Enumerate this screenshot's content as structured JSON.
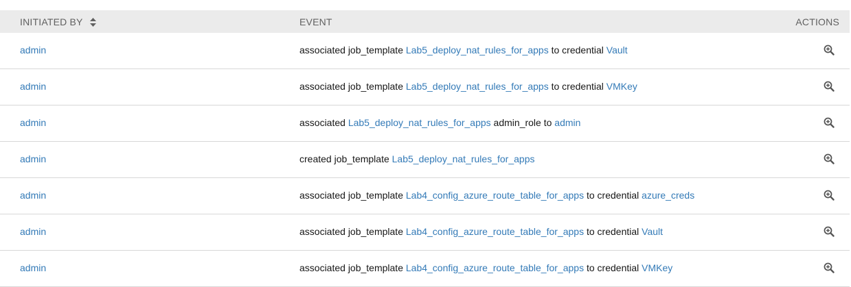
{
  "header": {
    "initiated_by": "INITIATED BY",
    "event": "EVENT",
    "actions": "ACTIONS"
  },
  "rows": [
    {
      "user": "admin",
      "pre": "associated job_template ",
      "obj1": "Lab5_deploy_nat_rules_for_apps",
      "mid": " to credential ",
      "obj2": "Vault"
    },
    {
      "user": "admin",
      "pre": "associated job_template ",
      "obj1": "Lab5_deploy_nat_rules_for_apps",
      "mid": " to credential ",
      "obj2": "VMKey"
    },
    {
      "user": "admin",
      "pre": "associated ",
      "obj1": "Lab5_deploy_nat_rules_for_apps",
      "mid": " admin_role to ",
      "obj2": "admin"
    },
    {
      "user": "admin",
      "pre": "created job_template ",
      "obj1": "Lab5_deploy_nat_rules_for_apps",
      "mid": "",
      "obj2": ""
    },
    {
      "user": "admin",
      "pre": "associated job_template ",
      "obj1": "Lab4_config_azure_route_table_for_apps",
      "mid": " to credential ",
      "obj2": "azure_creds"
    },
    {
      "user": "admin",
      "pre": "associated job_template ",
      "obj1": "Lab4_config_azure_route_table_for_apps",
      "mid": " to credential ",
      "obj2": "Vault"
    },
    {
      "user": "admin",
      "pre": "associated job_template ",
      "obj1": "Lab4_config_azure_route_table_for_apps",
      "mid": " to credential ",
      "obj2": "VMKey"
    }
  ],
  "icons": {
    "sort": "sort-icon",
    "view": "zoom-in-icon"
  },
  "colors": {
    "link": "#337ab7",
    "header_bg": "#ebebeb",
    "row_border": "#d7d7d7"
  }
}
